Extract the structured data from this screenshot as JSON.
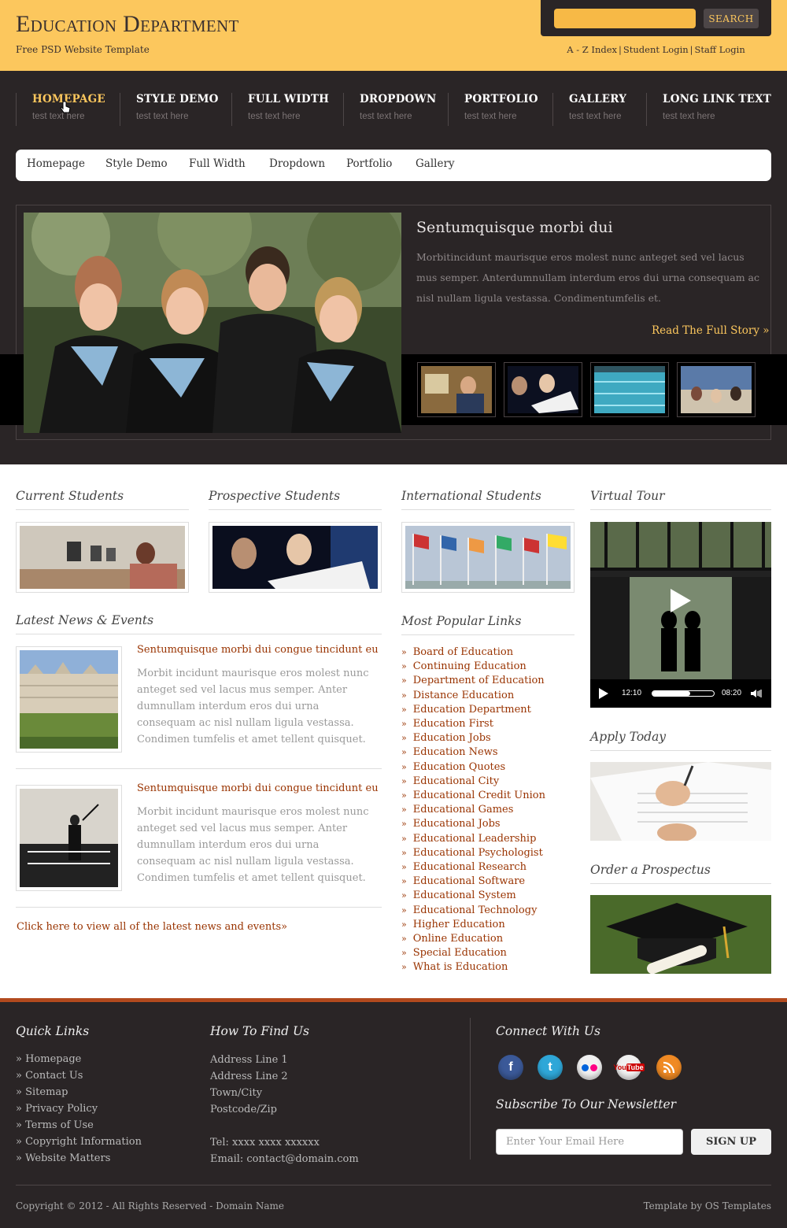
{
  "header": {
    "logo": "Education Department",
    "tagline": "Free PSD Website Template",
    "search_button": "SEARCH",
    "top_links": [
      "A - Z Index",
      "Student Login",
      "Staff Login"
    ]
  },
  "main_nav": [
    {
      "title": "HOMEPAGE",
      "sub": "test text here"
    },
    {
      "title": "STYLE DEMO",
      "sub": "test text here"
    },
    {
      "title": "FULL WIDTH",
      "sub": "test text here"
    },
    {
      "title": "DROPDOWN",
      "sub": "test text here"
    },
    {
      "title": "PORTFOLIO",
      "sub": "test text here"
    },
    {
      "title": "GALLERY",
      "sub": "test text here"
    },
    {
      "title": "LONG LINK TEXT",
      "sub": "test text here"
    }
  ],
  "breadcrumb_bar": [
    "Homepage",
    "Style Demo",
    "Full Width",
    "Dropdown",
    "Portfolio",
    "Gallery"
  ],
  "featured": {
    "title": "Sentumquisque morbi dui",
    "text": "Morbitincidunt maurisque eros molest nunc anteget sed vel lacus mus semper. Anterdumnullam interdum eros dui urna consequam ac nisl nullam ligula vestassa. Condimentumfelis et.",
    "more": "Read The Full Story »"
  },
  "sections": {
    "current": "Current Students",
    "prospective": "Prospective Students",
    "international": "International Students",
    "virtual_tour": "Virtual Tour",
    "news": "Latest News & Events",
    "popular": "Most Popular Links",
    "apply": "Apply Today",
    "prospectus": "Order a Prospectus"
  },
  "video": {
    "elapsed": "12:10",
    "total": "08:20",
    "progress": 0.62
  },
  "news": [
    {
      "title": "Sentumquisque morbi dui congue tincidunt eu",
      "text": "Morbit incidunt maurisque eros molest nunc anteget sed vel lacus mus semper. Anter dumnullam interdum eros dui urna consequam ac nisl nullam ligula vestassa. Condimen tumfelis et amet tellent quisquet."
    },
    {
      "title": "Sentumquisque morbi dui congue tincidunt eu",
      "text": "Morbit incidunt maurisque eros molest nunc anteget sed vel lacus mus semper. Anter dumnullam interdum eros dui urna consequam ac nisl nullam ligula vestassa. Condimen tumfelis et amet tellent quisquet."
    }
  ],
  "news_link": "Click here to view all of the latest news and events»",
  "popular_links": [
    "Board of Education",
    "Continuing Education",
    "Department of Education",
    "Distance Education",
    "Education Department",
    "Education First",
    "Education Jobs",
    "Education News",
    "Education Quotes",
    "Educational City",
    "Educational Credit Union",
    "Educational Games",
    "Educational Jobs",
    "Educational Leadership",
    "Educational Psychologist",
    "Educational Research",
    "Educational Software",
    "Educational System",
    "Educational Technology",
    "Higher Education",
    "Online Education",
    "Special Education",
    "What is Education"
  ],
  "footer": {
    "quick_title": "Quick Links",
    "quick_links": [
      "» Homepage",
      "» Contact Us",
      "» Sitemap",
      "» Privacy Policy",
      "» Terms of Use",
      "» Copyright Information",
      "» Website Matters"
    ],
    "find_title": "How To Find Us",
    "address": [
      "Address Line 1",
      "Address Line 2",
      "Town/City",
      "Postcode/Zip"
    ],
    "tel": "Tel: xxxx xxxx xxxxxx",
    "email": "Email: contact@domain.com",
    "connect_title": "Connect With Us",
    "newsletter_title": "Subscribe To Our Newsletter",
    "email_placeholder": "Enter Your Email Here",
    "signup": "SIGN UP",
    "copyright": "Copyright © 2012 - All Rights Reserved - Domain Name",
    "credit": "Template by OS Templates"
  },
  "social_icons": [
    "facebook-icon",
    "twitter-icon",
    "flickr-icon",
    "youtube-icon",
    "rss-icon"
  ],
  "colors": {
    "accent": "#fcc75d",
    "dark": "#2a2526",
    "link": "#993300",
    "footer_rule": "#b24a1e"
  }
}
